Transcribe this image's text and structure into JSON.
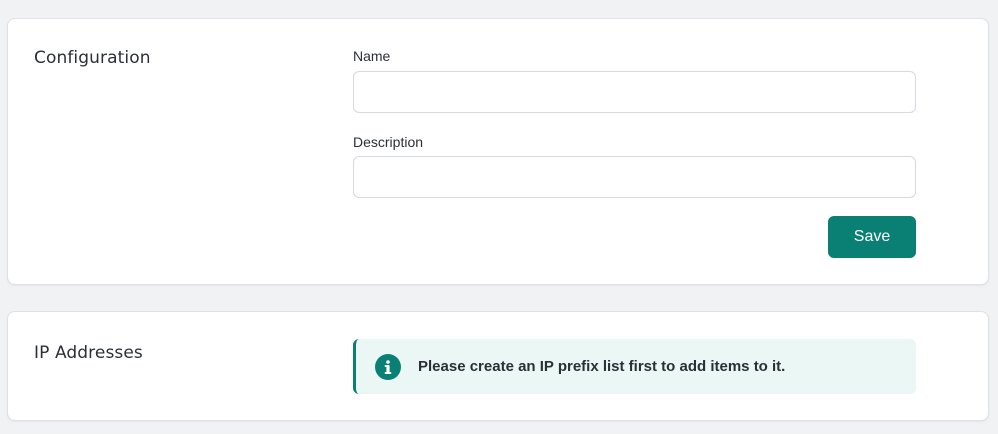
{
  "configuration": {
    "title": "Configuration",
    "name_label": "Name",
    "name_value": "",
    "description_label": "Description",
    "description_value": "",
    "save_label": "Save"
  },
  "ip_addresses": {
    "title": "IP Addresses",
    "info_message": "Please create an IP prefix list first to add items to it.",
    "info_icon": "info-icon"
  },
  "colors": {
    "accent": "#0a7f74",
    "info_background": "#eaf7f5",
    "page_background": "#f1f2f4"
  }
}
